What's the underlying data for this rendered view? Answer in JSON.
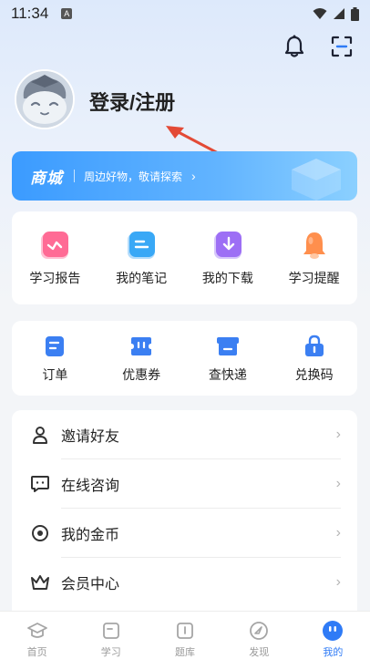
{
  "status_bar": {
    "time": "11:34",
    "notification_badge": "A"
  },
  "profile": {
    "login_label": "登录/注册"
  },
  "mall": {
    "title": "商城",
    "subtitle": "周边好物，敬请探索",
    "chevron": "›"
  },
  "features": [
    {
      "label": "学习报告",
      "icon": "report-icon",
      "color": "#ff5b8a"
    },
    {
      "label": "我的笔记",
      "icon": "notes-icon",
      "color": "#2fa5f6"
    },
    {
      "label": "我的下载",
      "icon": "download-icon",
      "color": "#9b6cf4"
    },
    {
      "label": "学习提醒",
      "icon": "bell-reminder-icon",
      "color": "#ff8a45"
    }
  ],
  "services": [
    {
      "label": "订单",
      "icon": "order-icon"
    },
    {
      "label": "优惠券",
      "icon": "coupon-icon"
    },
    {
      "label": "查快递",
      "icon": "express-icon"
    },
    {
      "label": "兑换码",
      "icon": "redeem-code-icon"
    }
  ],
  "menu": [
    {
      "label": "邀请好友",
      "icon": "invite-friend-icon"
    },
    {
      "label": "在线咨询",
      "icon": "chat-icon"
    },
    {
      "label": "我的金币",
      "icon": "coin-icon"
    },
    {
      "label": "会员中心",
      "icon": "crown-icon"
    }
  ],
  "tabs": [
    {
      "label": "首页",
      "icon": "graduation-cap-icon",
      "active": false
    },
    {
      "label": "学习",
      "icon": "study-icon",
      "active": false
    },
    {
      "label": "题库",
      "icon": "question-bank-icon",
      "active": false
    },
    {
      "label": "发现",
      "icon": "discover-icon",
      "active": false
    },
    {
      "label": "我的",
      "icon": "profile-tab-icon",
      "active": true
    }
  ],
  "colors": {
    "accent": "#2f7bf6",
    "service_icon": "#3b7ff2",
    "annotation_arrow": "#e34a36"
  }
}
